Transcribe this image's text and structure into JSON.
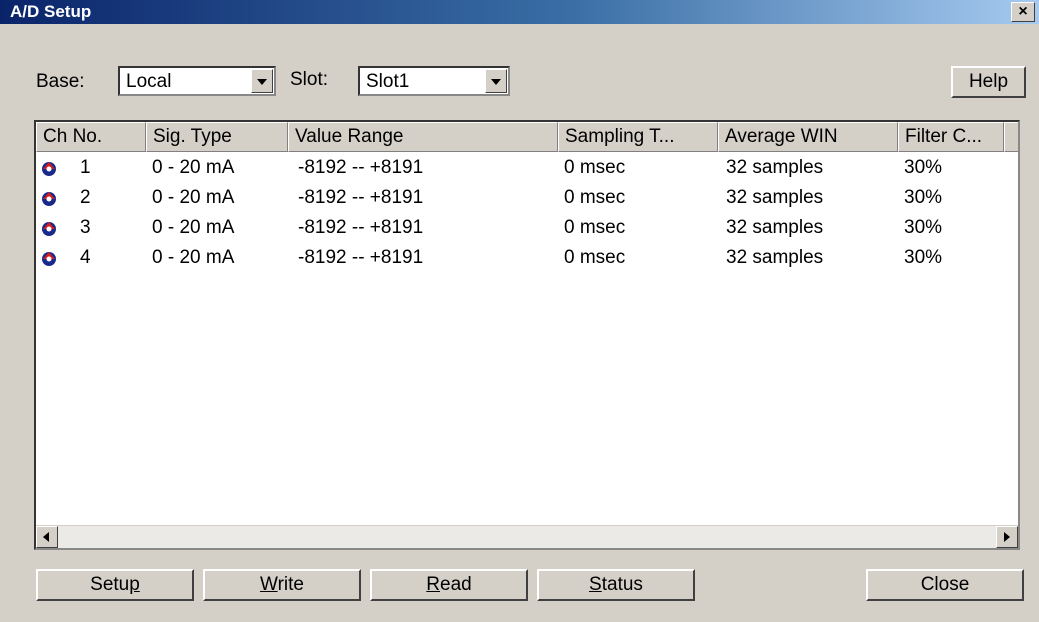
{
  "window": {
    "title": "A/D Setup",
    "close_glyph": "×"
  },
  "top": {
    "base_label": "Base:",
    "base_value": "Local",
    "slot_label": "Slot:",
    "slot_value": "Slot1",
    "help_label": "Help"
  },
  "table": {
    "columns": [
      "Ch No.",
      "Sig. Type",
      "Value Range",
      "Sampling T...",
      "Average WIN",
      "Filter C..."
    ],
    "rows": [
      {
        "ch": "1",
        "sig": "0 - 20 mA",
        "range": "-8192 -- +8191",
        "sampling": "0 msec",
        "avg": "32 samples",
        "filter": "30%"
      },
      {
        "ch": "2",
        "sig": "0 - 20 mA",
        "range": "-8192 -- +8191",
        "sampling": "0 msec",
        "avg": "32 samples",
        "filter": "30%"
      },
      {
        "ch": "3",
        "sig": "0 - 20 mA",
        "range": "-8192 -- +8191",
        "sampling": "0 msec",
        "avg": "32 samples",
        "filter": "30%"
      },
      {
        "ch": "4",
        "sig": "0 - 20 mA",
        "range": "-8192 -- +8191",
        "sampling": "0 msec",
        "avg": "32 samples",
        "filter": "30%"
      }
    ],
    "row_icon": "channel-icon"
  },
  "buttons": {
    "setup": {
      "pre": "Setu",
      "key": "p",
      "post": ""
    },
    "write": {
      "pre": "",
      "key": "W",
      "post": "rite"
    },
    "read": {
      "pre": "",
      "key": "R",
      "post": "ead"
    },
    "status": {
      "pre": "",
      "key": "S",
      "post": "tatus"
    },
    "close": "Close"
  },
  "colors": {
    "title_start": "#0a246a",
    "title_end": "#a6caf0",
    "face": "#d4d0c8"
  }
}
